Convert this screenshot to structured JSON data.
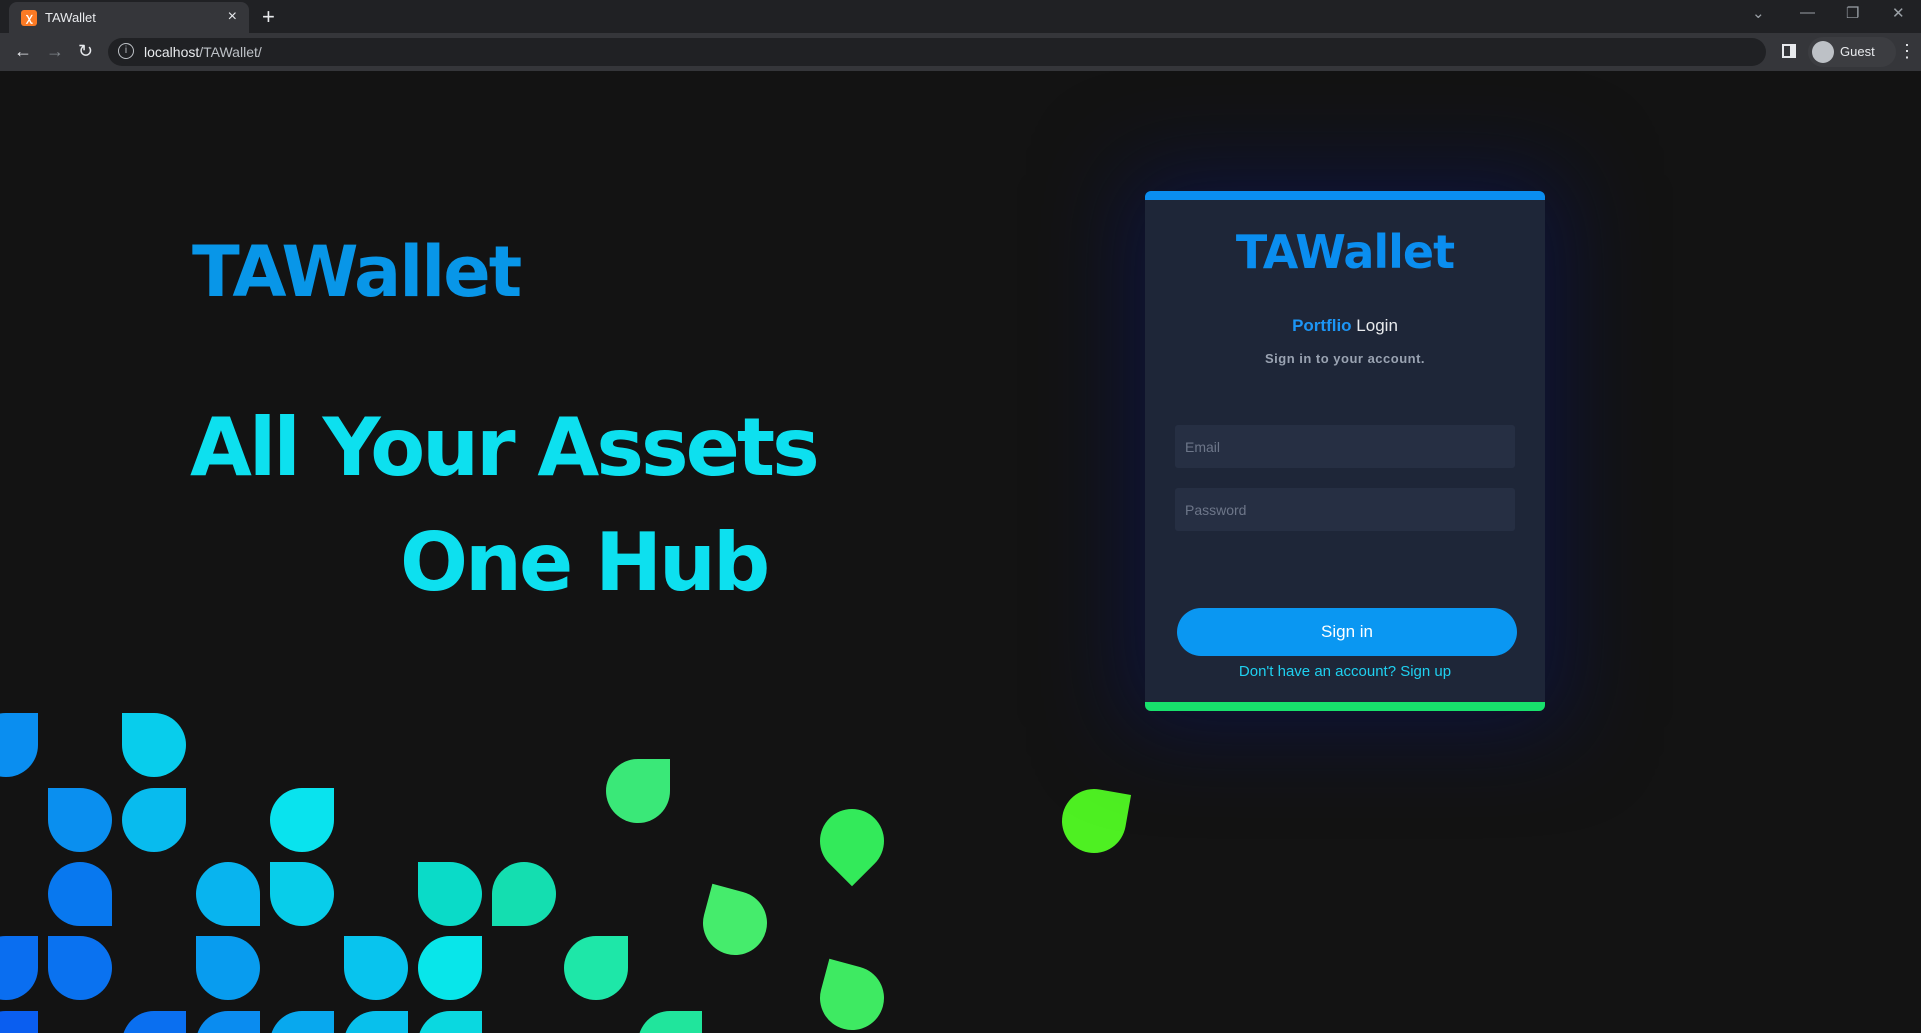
{
  "browser": {
    "tab_title": "TAWallet",
    "tab_favicon": "xampp-icon",
    "url_host": "localhost",
    "url_path": "/TAWallet/",
    "profile_label": "Guest"
  },
  "hero": {
    "brand": "TAWallet",
    "line1": "All Your Assets",
    "line2": "One Hub"
  },
  "login": {
    "brand": "TAWallet",
    "subtitle_highlight": "Portflio",
    "subtitle_rest": " Login",
    "tagline": "Sign in to your account.",
    "email_placeholder": "Email",
    "password_placeholder": "Password",
    "signin_label": "Sign in",
    "signup_link": "Don't have an account? Sign up"
  },
  "colors": {
    "accent_blue": "#0a8ef0",
    "accent_cyan": "#0de0ef",
    "accent_green": "#18e26c",
    "card_bg": "#1e2638"
  }
}
